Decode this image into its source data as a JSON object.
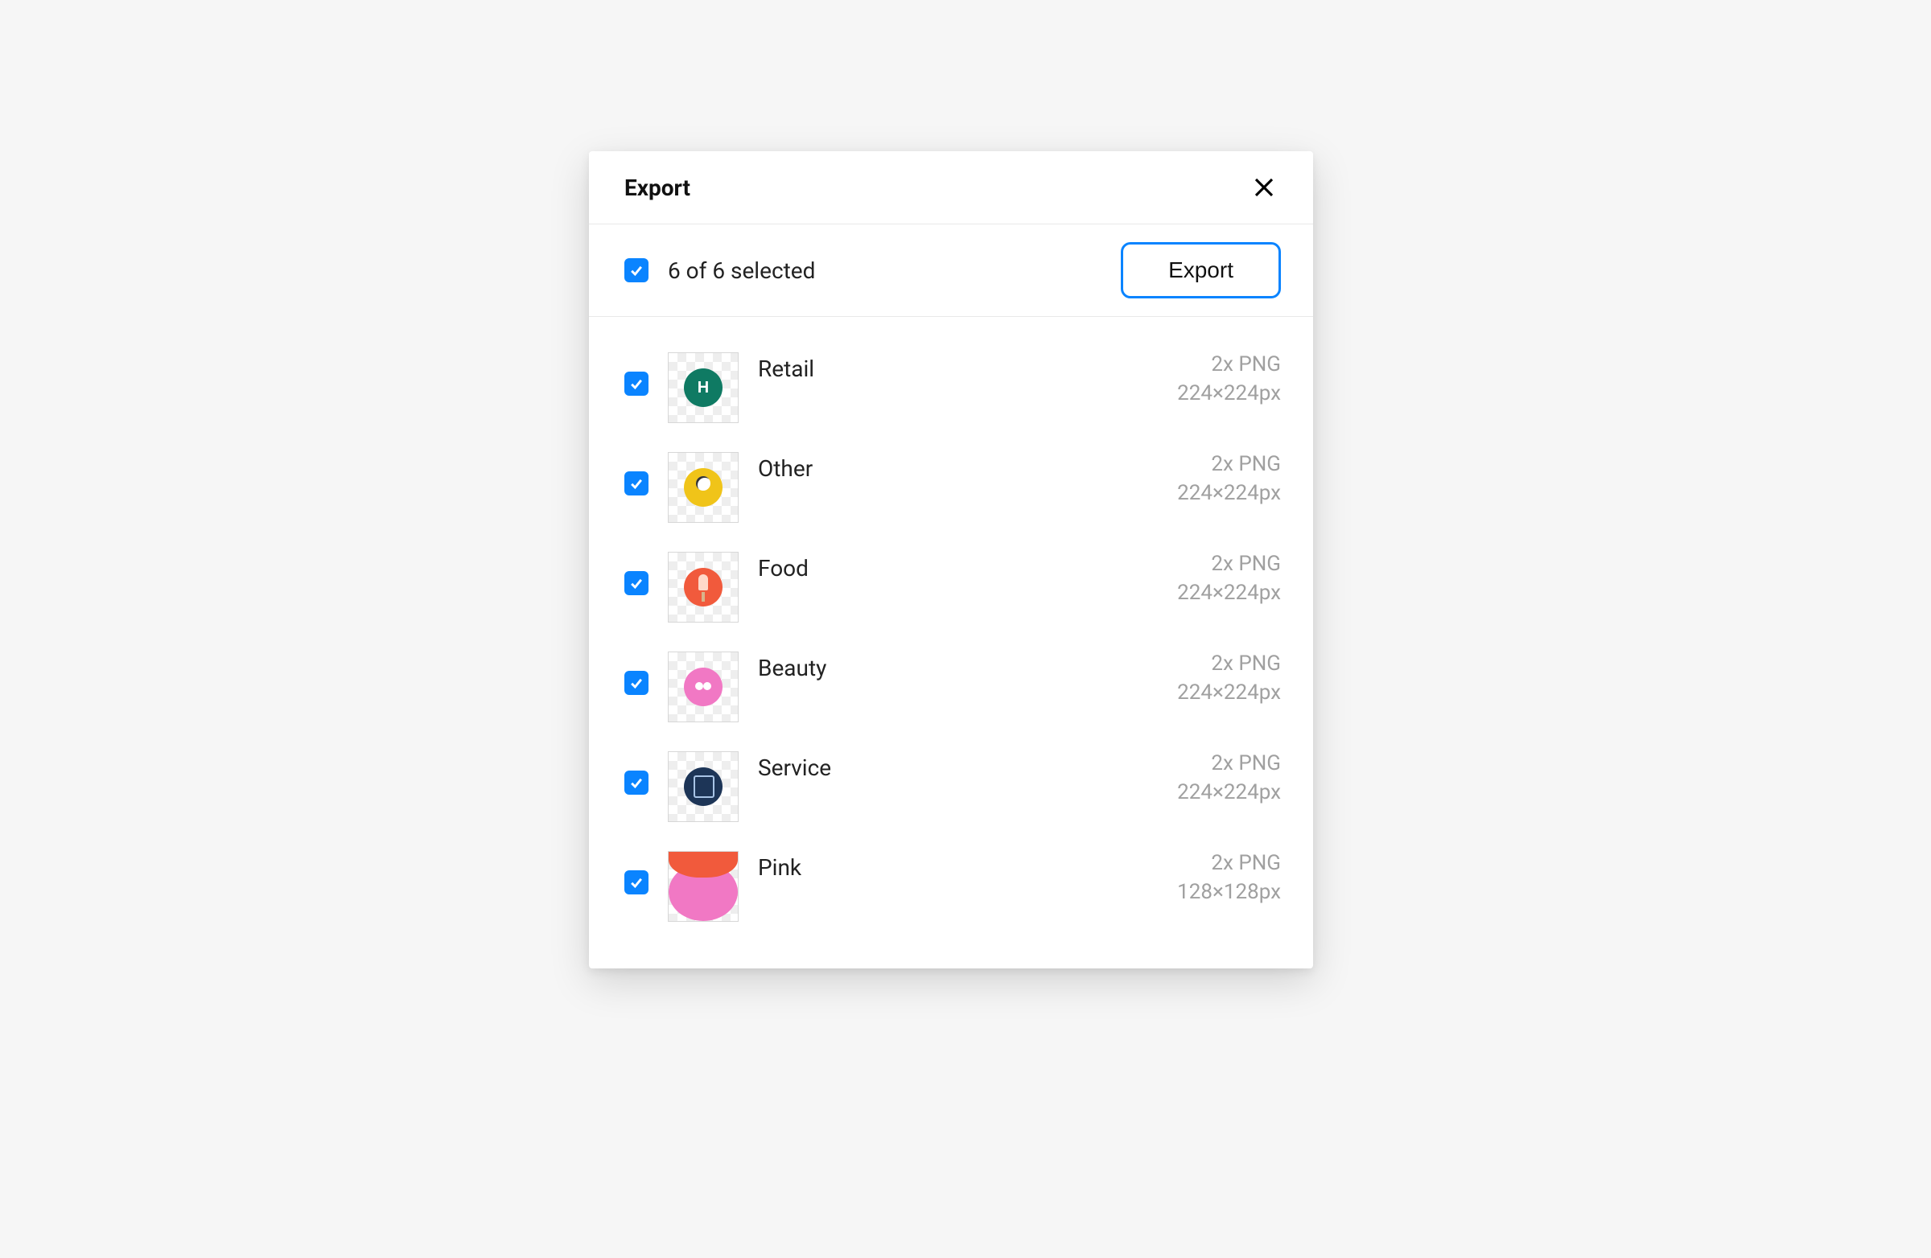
{
  "dialog": {
    "title": "Export",
    "close_label": "Close"
  },
  "toolbar": {
    "selected_text": "6 of 6 selected",
    "export_label": "Export"
  },
  "items": [
    {
      "name": "Retail",
      "format": "2x PNG",
      "size": "224×224px",
      "checked": true,
      "icon": "retail"
    },
    {
      "name": "Other",
      "format": "2x PNG",
      "size": "224×224px",
      "checked": true,
      "icon": "other"
    },
    {
      "name": "Food",
      "format": "2x PNG",
      "size": "224×224px",
      "checked": true,
      "icon": "food"
    },
    {
      "name": "Beauty",
      "format": "2x PNG",
      "size": "224×224px",
      "checked": true,
      "icon": "beauty"
    },
    {
      "name": "Service",
      "format": "2x PNG",
      "size": "224×224px",
      "checked": true,
      "icon": "service"
    },
    {
      "name": "Pink",
      "format": "2x PNG",
      "size": "128×128px",
      "checked": true,
      "icon": "pink"
    }
  ]
}
